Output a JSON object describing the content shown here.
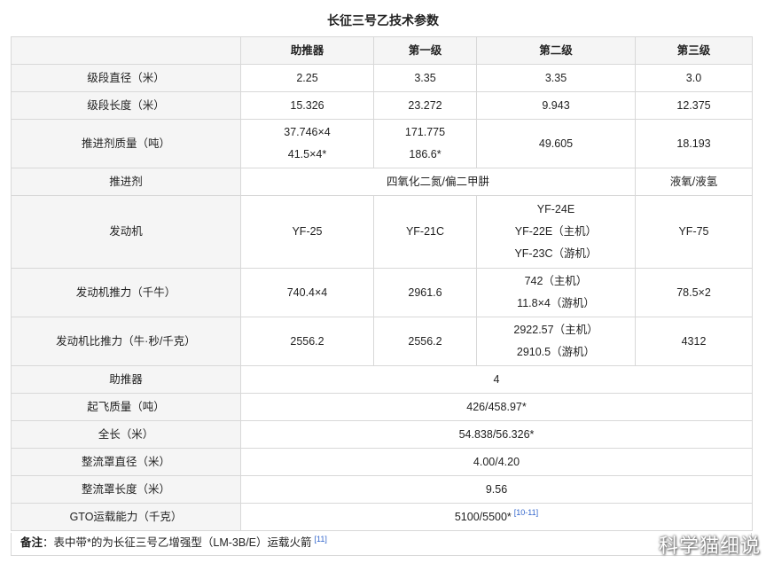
{
  "title": "长征三号乙技术参数",
  "header": {
    "corner": "",
    "booster": "助推器",
    "stage1": "第一级",
    "stage2": "第二级",
    "stage3": "第三级"
  },
  "rows": {
    "diameter": {
      "label": "级段直径（米）",
      "booster": "2.25",
      "stage1": "3.35",
      "stage2": "3.35",
      "stage3": "3.0"
    },
    "length": {
      "label": "级段长度（米）",
      "booster": "15.326",
      "stage1": "23.272",
      "stage2": "9.943",
      "stage3": "12.375"
    },
    "propellant_mass": {
      "label": "推进剂质量（吨）",
      "booster": [
        "37.746×4",
        "41.5×4*"
      ],
      "stage1": [
        "171.775",
        "186.6*"
      ],
      "stage2": "49.605",
      "stage3": "18.193"
    },
    "propellant": {
      "label": "推进剂",
      "stages_1_2": "四氧化二氮/偏二甲肼",
      "stage3": "液氧/液氢"
    },
    "engine": {
      "label": "发动机",
      "booster": "YF-25",
      "stage1": "YF-21C",
      "stage2": [
        "YF-24E",
        "YF-22E（主机）",
        "YF-23C（游机）"
      ],
      "stage3": "YF-75"
    },
    "thrust": {
      "label": "发动机推力（千牛）",
      "booster": "740.4×4",
      "stage1": "2961.6",
      "stage2": [
        "742（主机）",
        "11.8×4（游机）"
      ],
      "stage3": "78.5×2"
    },
    "specific_impulse": {
      "label": "发动机比推力（牛·秒/千克）",
      "booster": "2556.2",
      "stage1": "2556.2",
      "stage2": [
        "2922.57（主机）",
        "2910.5（游机）"
      ],
      "stage3": "4312"
    },
    "boosters": {
      "label": "助推器",
      "value": "4"
    },
    "liftoff_mass": {
      "label": "起飞质量（吨）",
      "value": "426/458.97*"
    },
    "total_length": {
      "label": "全长（米）",
      "value": "54.838/56.326*"
    },
    "fairing_diameter": {
      "label": "整流罩直径（米）",
      "value": "4.00/4.20"
    },
    "fairing_length": {
      "label": "整流罩长度（米）",
      "value": "9.56"
    },
    "gto_capacity": {
      "label": "GTO运载能力（千克）",
      "value": "5100/5500*",
      "ref": "[10-11]"
    }
  },
  "note": {
    "label": "备注",
    "text": "：表中带*的为长征三号乙增强型（LM-3B/E）运载火箭",
    "ref": "[11]"
  },
  "watermark": "科学猫细说"
}
